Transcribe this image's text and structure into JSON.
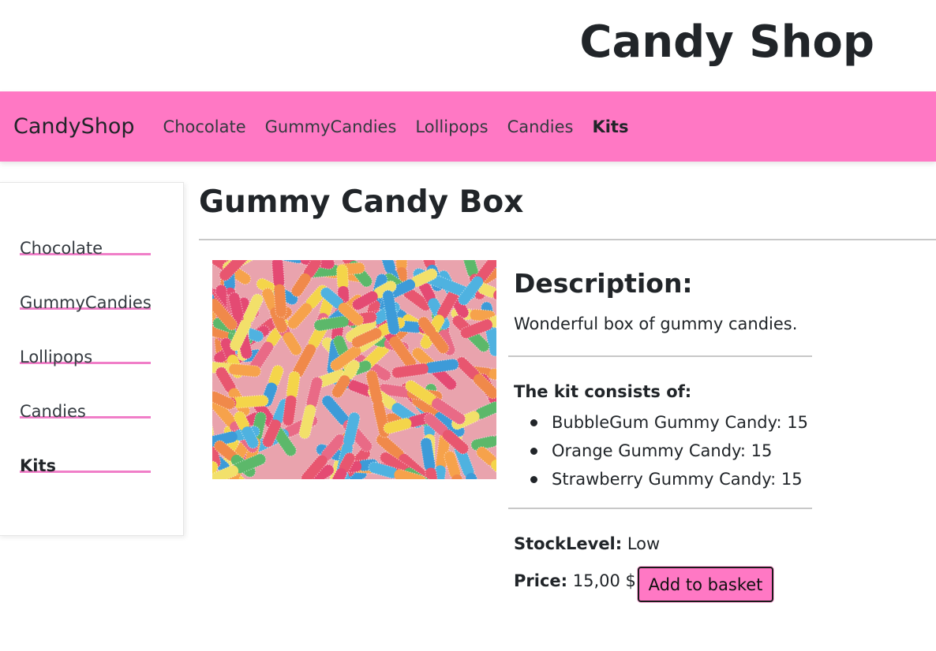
{
  "site": {
    "title": "Candy Shop"
  },
  "navbar": {
    "brand": "CandyShop",
    "items": [
      {
        "label": "Chocolate",
        "active": false
      },
      {
        "label": "GummyCandies",
        "active": false
      },
      {
        "label": "Lollipops",
        "active": false
      },
      {
        "label": "Candies",
        "active": false
      },
      {
        "label": "Kits",
        "active": true
      }
    ],
    "background_color": "#ff78c4"
  },
  "sidebar": {
    "items": [
      {
        "label": "Chocolate",
        "active": false
      },
      {
        "label": "GummyCandies",
        "active": false
      },
      {
        "label": "Lollipops",
        "active": false
      },
      {
        "label": "Candies",
        "active": false
      },
      {
        "label": "Kits",
        "active": true
      }
    ],
    "underline_color": "#f07ec8"
  },
  "product": {
    "title": "Gummy Candy Box",
    "image_alt": "gummy-worms-photo",
    "description_heading": "Description:",
    "description": "Wonderful box of gummy candies.",
    "kit_heading": "The kit consists of:",
    "kit_items": [
      "BubbleGum Gummy Candy: 15",
      "Orange Gummy Candy: 15",
      "Strawberry Gummy Candy: 15"
    ],
    "stock_label": "StockLevel:",
    "stock_value": "Low",
    "price_label": "Price:",
    "price_value": "15,00 $",
    "add_button_label": "Add to basket",
    "button_color": "#ff78c4"
  }
}
